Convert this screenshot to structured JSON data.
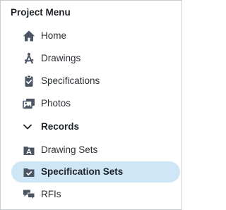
{
  "menu": {
    "title": "Project Menu",
    "items": [
      {
        "label": "Home",
        "icon": "home-icon"
      },
      {
        "label": "Drawings",
        "icon": "drafting-compass-icon"
      },
      {
        "label": "Specifications",
        "icon": "clipboard-check-icon"
      },
      {
        "label": "Photos",
        "icon": "photos-icon"
      }
    ],
    "section": {
      "label": "Records",
      "icon": "chevron-down-icon",
      "items": [
        {
          "label": "Drawing Sets",
          "icon": "drawing-set-icon"
        },
        {
          "label": "Specification Sets",
          "icon": "specification-set-icon",
          "selected": true
        },
        {
          "label": "RFIs",
          "icon": "chat-bubbles-icon"
        }
      ]
    }
  },
  "colors": {
    "icon": "#4b5563",
    "selected_bg": "#cfe6f7",
    "border": "#c9cdd2"
  }
}
